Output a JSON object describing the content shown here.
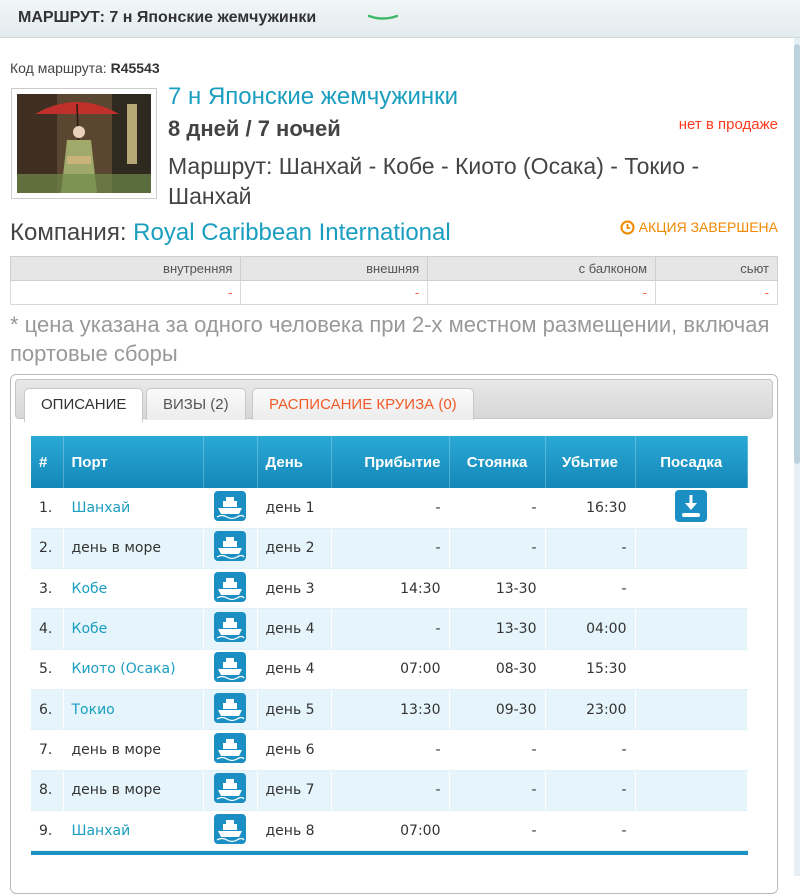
{
  "header": {
    "title": "МАРШРУТ: 7 н Японские жемчужинки"
  },
  "route_code": {
    "label": "Код маршрута:",
    "value": "R45543"
  },
  "cruise": {
    "title": "7 н Японские жемчужинки",
    "duration": "8 дней / 7 ночей",
    "status": "нет в продаже",
    "route": "Маршрут: Шанхай - Кобе - Киото (Осака) - Токио - Шанхай"
  },
  "company": {
    "label": "Компания:",
    "name": "Royal Caribbean International"
  },
  "promo": {
    "label": "АКЦИЯ ЗАВЕРШЕНА",
    "icon": "clock-icon"
  },
  "prices": {
    "headers": [
      "внутренняя",
      "внешняя",
      "с балконом",
      "сьют"
    ],
    "values": [
      "-",
      "-",
      "-",
      "-"
    ]
  },
  "note": "* цена указана за одного человека при 2-х местном размещении, включая портовые сборы",
  "tabs": [
    {
      "label": "ОПИСАНИЕ"
    },
    {
      "label": "ВИЗЫ (2)"
    },
    {
      "label": "РАСПИСАНИЕ КРУИЗА (0)"
    }
  ],
  "itinerary": {
    "headers": {
      "num": "#",
      "port": "Порт",
      "day": "День",
      "arrival": "Прибытие",
      "stay": "Стоянка",
      "departure": "Убытие",
      "boarding": "Посадка"
    },
    "rows": [
      {
        "num": "1.",
        "port": "Шанхай",
        "day": "день 1",
        "arrival": "-",
        "stay": "-",
        "departure": "16:30"
      },
      {
        "num": "2.",
        "port": "день в море",
        "day": "день 2",
        "arrival": "-",
        "stay": "-",
        "departure": "-"
      },
      {
        "num": "3.",
        "port": "Кобе",
        "day": "день 3",
        "arrival": "14:30",
        "stay": "13-30",
        "departure": "-"
      },
      {
        "num": "4.",
        "port": "Кобе",
        "day": "день 4",
        "arrival": "-",
        "stay": "13-30",
        "departure": "04:00"
      },
      {
        "num": "5.",
        "port": "Киото (Осака)",
        "day": "день 4",
        "arrival": "07:00",
        "stay": "08-30",
        "departure": "15:30"
      },
      {
        "num": "6.",
        "port": "Токио",
        "day": "день 5",
        "arrival": "13:30",
        "stay": "09-30",
        "departure": "23:00"
      },
      {
        "num": "7.",
        "port": "день в море",
        "day": "день 6",
        "arrival": "-",
        "stay": "-",
        "departure": "-"
      },
      {
        "num": "8.",
        "port": "день в море",
        "day": "день 7",
        "arrival": "-",
        "stay": "-",
        "departure": "-"
      },
      {
        "num": "9.",
        "port": "Шанхай",
        "day": "день 8",
        "arrival": "07:00",
        "stay": "-",
        "departure": "-"
      }
    ]
  },
  "colors": {
    "accent": "#1a9ec0",
    "status": "#ff3b1f",
    "promo": "#f08a00",
    "table_header": "#1d96c8"
  }
}
